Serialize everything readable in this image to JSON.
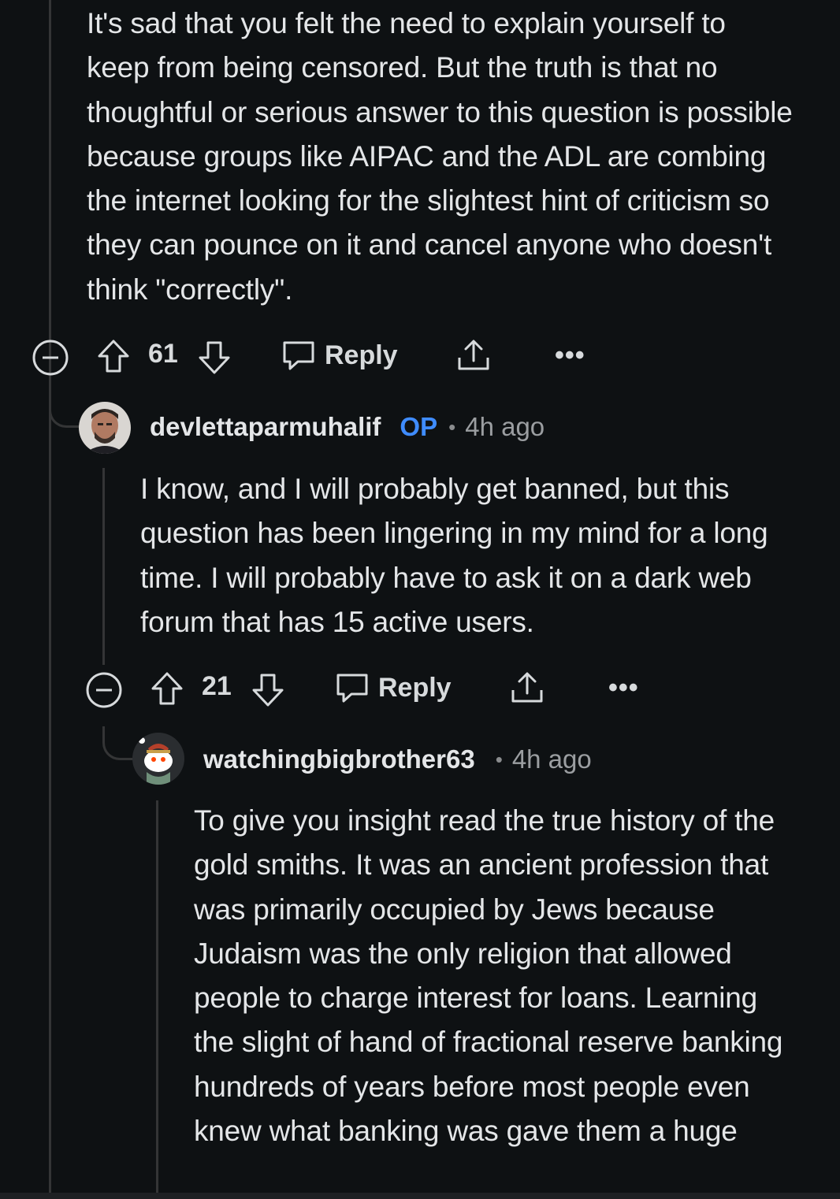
{
  "comment_top": {
    "text": "It's sad that you felt the need to explain yourself to keep from being censored. But the truth is that no thoughtful or serious answer to this question is possible because groups like AIPAC and the ADL are combing the internet looking for the slightest hint of criticism so they can pounce on it and cancel anyone who doesn't think \"correctly\".",
    "votes": "61",
    "reply_label": "Reply",
    "more_label": "•••"
  },
  "comment_op": {
    "username": "devlettaparmuhalif",
    "badge": "OP",
    "separator": "•",
    "time": "4h ago",
    "text": "I know, and I will probably get banned, but this question has been lingering in my mind for a long time. I will probably have to ask it on a dark web forum that has 15 active users.",
    "votes": "21",
    "reply_label": "Reply",
    "more_label": "•••"
  },
  "comment_third": {
    "username": "watchingbigbrother63",
    "separator": "•",
    "time": "4h ago",
    "text": "To give you insight read the true history of the gold smiths. It was an ancient profession that was primarily occupied by Jews because Judaism was the only religion that allowed people to charge interest for loans. Learning the slight of hand of fractional reserve banking hundreds of years before most people even knew what banking was gave them a huge"
  },
  "colors": {
    "background": "#0e1113",
    "text": "#e4e6e8",
    "op_badge": "#3f8cff",
    "thread_line": "#343536",
    "muted": "#9b9ea1"
  }
}
